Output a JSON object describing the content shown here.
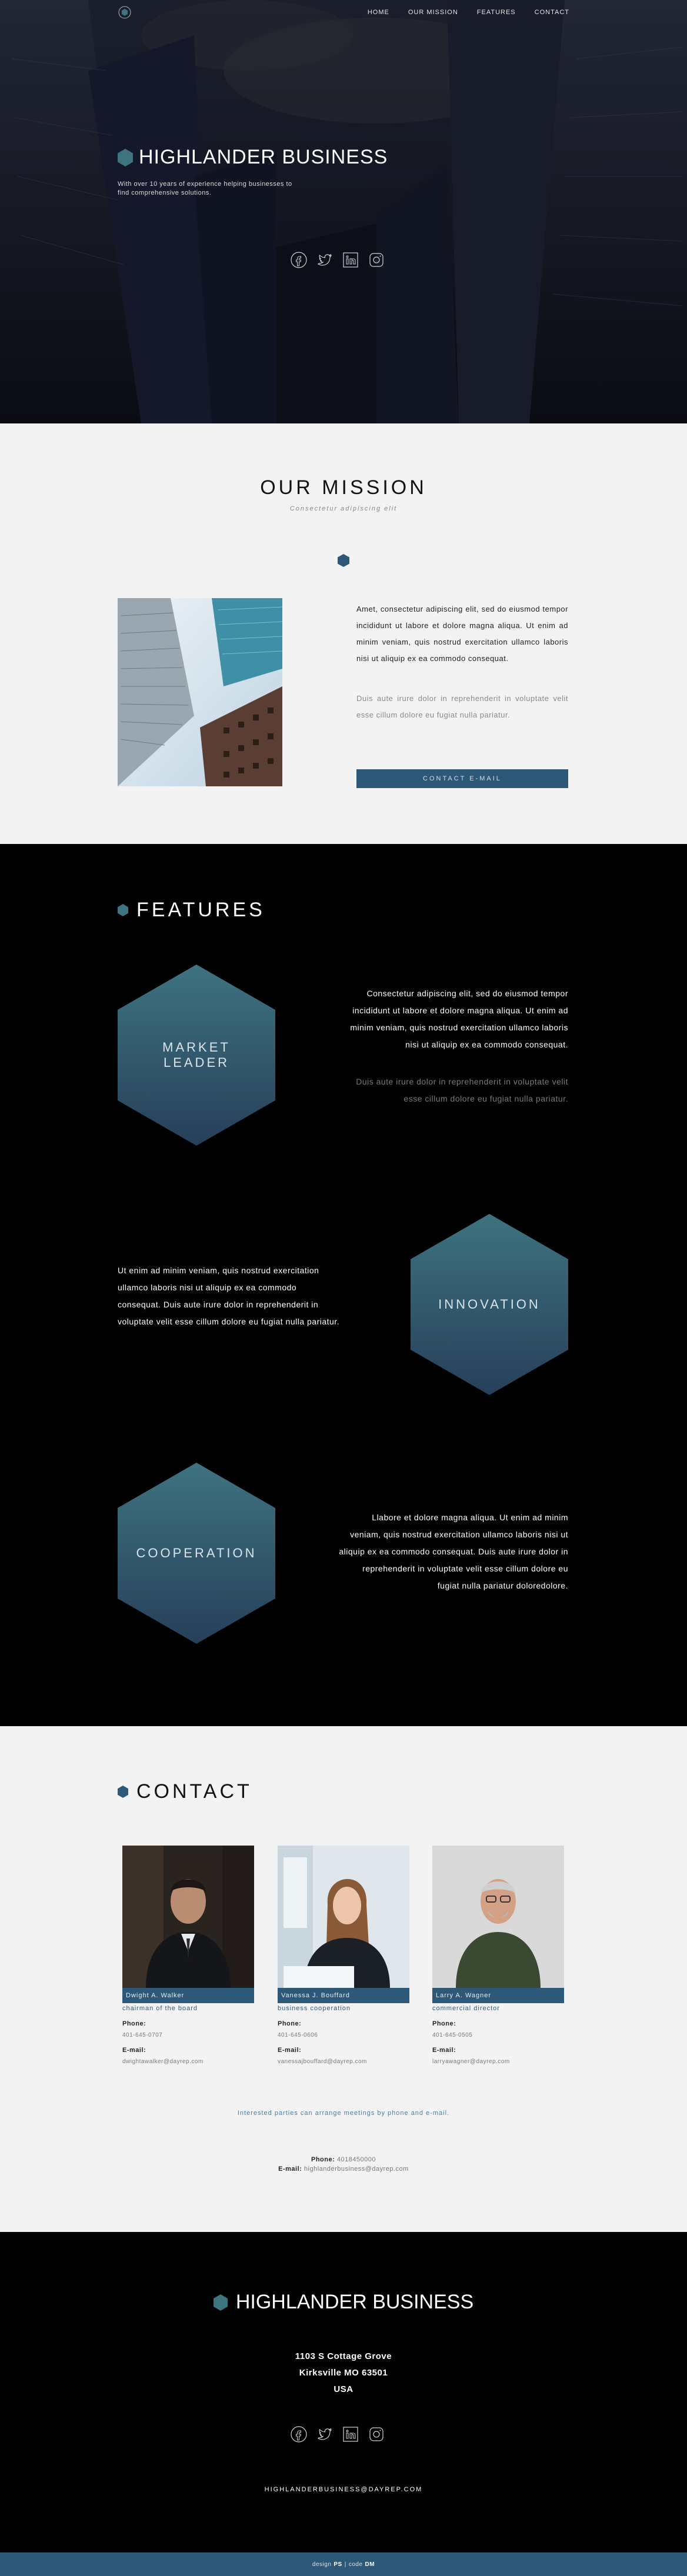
{
  "nav": {
    "items": [
      "HOME",
      "OUR MISSION",
      "FEATURES",
      "CONTACT"
    ]
  },
  "hero": {
    "title": "HIGHLANDER BUSINESS",
    "subtitle": "With over 10 years of experience helping businesses to find comprehensive solutions.",
    "social_icons": [
      "facebook-icon",
      "twitter-icon",
      "linkedin-icon",
      "instagram-icon"
    ]
  },
  "mission": {
    "title": "OUR MISSION",
    "subtitle": "Consectetur adipiscing elit",
    "paragraph1": "Amet, consectetur adipiscing elit, sed do eiusmod tempor incididunt ut labore et dolore magna aliqua. Ut enim ad minim veniam, quis nostrud exercitation ullamco laboris nisi ut aliquip ex ea commodo consequat.",
    "paragraph2": "Duis aute irure dolor in reprehenderit in voluptate velit esse cillum dolore eu fugiat nulla pariatur.",
    "button": "CONTACT E-MAIL"
  },
  "features": {
    "title": "FEATURES",
    "items": [
      {
        "label_line1": "MARKET",
        "label_line2": "LEADER",
        "text": "Consectetur adipiscing elit, sed do eiusmod tempor incididunt ut labore et dolore magna aliqua. Ut enim ad minim veniam, quis nostrud exercitation ullamco laboris nisi ut aliquip ex ea commodo consequat.",
        "muted": "Duis aute irure dolor in reprehenderit in voluptate velit esse cillum dolore eu fugiat nulla pariatur."
      },
      {
        "label_line1": "INNOVATION",
        "text": "Ut enim ad minim veniam, quis nostrud exercitation ullamco laboris nisi ut aliquip ex ea commodo consequat. Duis aute irure dolor in reprehenderit in voluptate velit esse cillum dolore eu fugiat nulla pariatur."
      },
      {
        "label_line1": "COOPERATION",
        "text": "Llabore et dolore magna aliqua. Ut enim ad minim veniam, quis nostrud exercitation ullamco laboris nisi ut aliquip ex ea commodo consequat. Duis aute irure dolor in reprehenderit in voluptate velit esse cillum dolore eu fugiat nulla pariatur doloredolore."
      }
    ]
  },
  "contact": {
    "title": "CONTACT",
    "phone_label": "Phone:",
    "email_label": "E-mail:",
    "people": [
      {
        "name": "Dwight A. Walker",
        "role": "chairman of the board",
        "phone": "401-645-0707",
        "email": "dwightawalker@dayrep.com"
      },
      {
        "name": "Vanessa J. Bouffard",
        "role": "business cooperation",
        "phone": "401-645-0606",
        "email": "vanessajbouffard@dayrep.com"
      },
      {
        "name": "Larry A. Wagner",
        "role": "commercial director",
        "phone": "401-645-0505",
        "email": "larryawagner@dayrep.com"
      }
    ],
    "note": "Interested parties can arrange meetings by phone and e-mail.",
    "main_phone": "4018450000",
    "main_email": "highlanderbusiness@dayrep.com"
  },
  "footer": {
    "title": "HIGHLANDER BUSINESS",
    "address_line1": "1103 S Cottage Grove",
    "address_line2": "Kirksville MO 63501",
    "address_line3": "USA",
    "email": "HIGHLANDERBUSINESS@DAYREP.COM",
    "credits_design_label": "design",
    "credits_design": "PS",
    "credits_sep": "|",
    "credits_code_label": "code",
    "credits_code": "DM"
  },
  "colors": {
    "accent": "#2d5877",
    "hex_top": "#3e7380",
    "hex_bottom": "#273f5a"
  }
}
